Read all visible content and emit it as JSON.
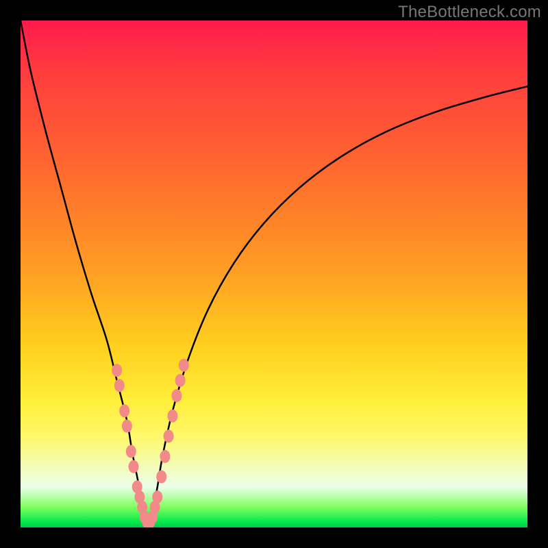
{
  "watermark": "TheBottleneck.com",
  "colors": {
    "background": "#000000",
    "curve": "#000000",
    "dot_fill": "#f28a8a",
    "dot_stroke": "#b85454",
    "gradient_stops": [
      "#ff1a4d",
      "#ff3c3e",
      "#ff6a2e",
      "#ff9a24",
      "#ffcf1e",
      "#ffee3a",
      "#fff86a",
      "#eaffea",
      "#7fff5f",
      "#00e84a",
      "#05c647"
    ]
  },
  "chart_data": {
    "type": "line",
    "title": "",
    "xlabel": "",
    "ylabel": "",
    "xlim": [
      0,
      100
    ],
    "ylim": [
      0,
      100
    ],
    "notch_x": 25,
    "series": [
      {
        "name": "bottleneck-curve",
        "x": [
          0,
          2,
          5,
          8,
          11,
          14,
          17,
          19,
          21,
          22,
          23,
          24,
          24.5,
          25,
          26,
          27,
          28,
          30,
          33,
          37,
          42,
          48,
          55,
          63,
          72,
          82,
          92,
          100
        ],
        "y": [
          100,
          90,
          78,
          67,
          56,
          46,
          37,
          29,
          21,
          15,
          10,
          5,
          2,
          0,
          3,
          8,
          14,
          23,
          33,
          43,
          52,
          60,
          67,
          73,
          78,
          82,
          85,
          87
        ]
      }
    ],
    "dots": {
      "name": "highlight-points",
      "points": [
        {
          "x": 19.0,
          "y": 31
        },
        {
          "x": 19.5,
          "y": 28
        },
        {
          "x": 20.5,
          "y": 23
        },
        {
          "x": 21.0,
          "y": 20
        },
        {
          "x": 21.8,
          "y": 15
        },
        {
          "x": 22.3,
          "y": 12
        },
        {
          "x": 23.0,
          "y": 8
        },
        {
          "x": 23.5,
          "y": 6
        },
        {
          "x": 24.0,
          "y": 4
        },
        {
          "x": 24.5,
          "y": 2
        },
        {
          "x": 25.0,
          "y": 1
        },
        {
          "x": 25.5,
          "y": 1
        },
        {
          "x": 26.0,
          "y": 2
        },
        {
          "x": 26.5,
          "y": 4
        },
        {
          "x": 27.0,
          "y": 6
        },
        {
          "x": 27.8,
          "y": 10
        },
        {
          "x": 28.5,
          "y": 14
        },
        {
          "x": 29.2,
          "y": 18
        },
        {
          "x": 30.0,
          "y": 22
        },
        {
          "x": 30.8,
          "y": 26
        },
        {
          "x": 31.5,
          "y": 29
        },
        {
          "x": 32.2,
          "y": 32
        }
      ]
    }
  }
}
